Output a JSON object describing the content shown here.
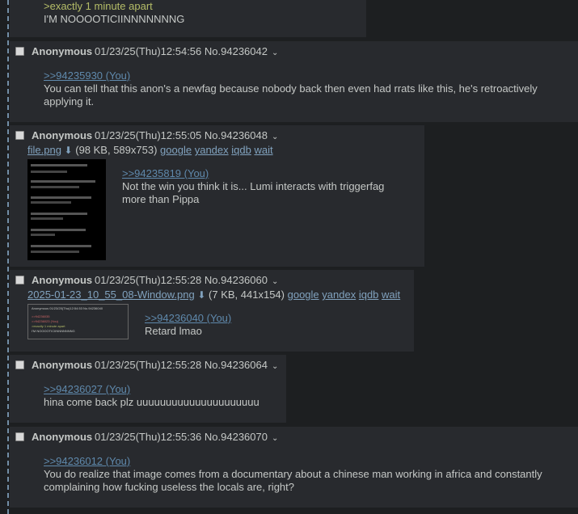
{
  "posts": [
    {
      "greentext": ">exactly 1 minute apart",
      "text": "I'M NOOOOTICIINNNNNNNG"
    },
    {
      "name": "Anonymous",
      "date": "01/23/25(Thu)12:54:56",
      "number": "No.94236042",
      "quote": ">>94235930 (You)",
      "text": "You can tell that this anon's a newfag because nobody back then even had rrats like this, he's retroactively applying it."
    },
    {
      "name": "Anonymous",
      "date": "01/23/25(Thu)12:55:05",
      "number": "No.94236048",
      "file_name": "file.png",
      "file_info": "(98 KB, 589x753)",
      "quote": ">>94235819 (You)",
      "text": "Not the win you think it is... Lumi interacts with triggerfag more than Pippa"
    },
    {
      "name": "Anonymous",
      "date": "01/23/25(Thu)12:55:28",
      "number": "No.94236060",
      "file_name": "2025-01-23_10_55_08-Window.png",
      "file_info": "(7 KB, 441x154)",
      "quote": ">>94236040 (You)",
      "text": "Retard lmao",
      "thumb_lines": [
        "Anonymous 01/23/25(Thu)12:54:53 No.94236040",
        ">>94236035",
        ">>94236023 (You)",
        ">exactly 1 minute apart",
        "I'M NOOOOTICIINNNNNNNG"
      ]
    },
    {
      "name": "Anonymous",
      "date": "01/23/25(Thu)12:55:28",
      "number": "No.94236064",
      "quote": ">>94236027 (You)",
      "text": "hina come back plz uuuuuuuuuuuuuuuuuuuuu"
    },
    {
      "name": "Anonymous",
      "date": "01/23/25(Thu)12:55:36",
      "number": "No.94236070",
      "quote": ">>94236012 (You)",
      "text": "You do realize that image comes from a documentary about a chinese man working in africa and constantly complaining how fucking useless the locals are, right?"
    }
  ],
  "search_links": [
    "google",
    "yandex",
    "iqdb",
    "wait"
  ],
  "icons": {
    "menu": "chevron-down-icon",
    "download": "download-icon",
    "select": "checkbox-icon"
  }
}
